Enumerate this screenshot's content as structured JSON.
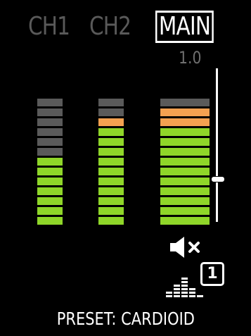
{
  "tabs": [
    {
      "label": "CH1",
      "active": false
    },
    {
      "label": "CH2",
      "active": false
    },
    {
      "label": "MAIN",
      "active": true
    }
  ],
  "fader": {
    "value_label": "1.0",
    "level": 0.28
  },
  "meters": {
    "ch1": [
      "off",
      "off",
      "off",
      "off",
      "off",
      "off",
      "green",
      "green",
      "green",
      "green",
      "green",
      "green",
      "green"
    ],
    "ch2": [
      "off",
      "off",
      "orange",
      "green",
      "green",
      "green",
      "green",
      "green",
      "green",
      "green",
      "green",
      "green",
      "green"
    ],
    "main": [
      "off",
      "orange",
      "orange",
      "green",
      "green",
      "green",
      "green",
      "green",
      "green",
      "green",
      "green",
      "green",
      "green"
    ]
  },
  "colors": {
    "green": "#8fd629",
    "orange": "#f4a151",
    "off": "#5a5a5a",
    "inactive_tab": "#595959"
  },
  "icons": {
    "mute": "speaker-muted-icon",
    "eq": "eq-bars-icon"
  },
  "preset": {
    "number": "1",
    "label": "PRESET: CARDIOID"
  }
}
